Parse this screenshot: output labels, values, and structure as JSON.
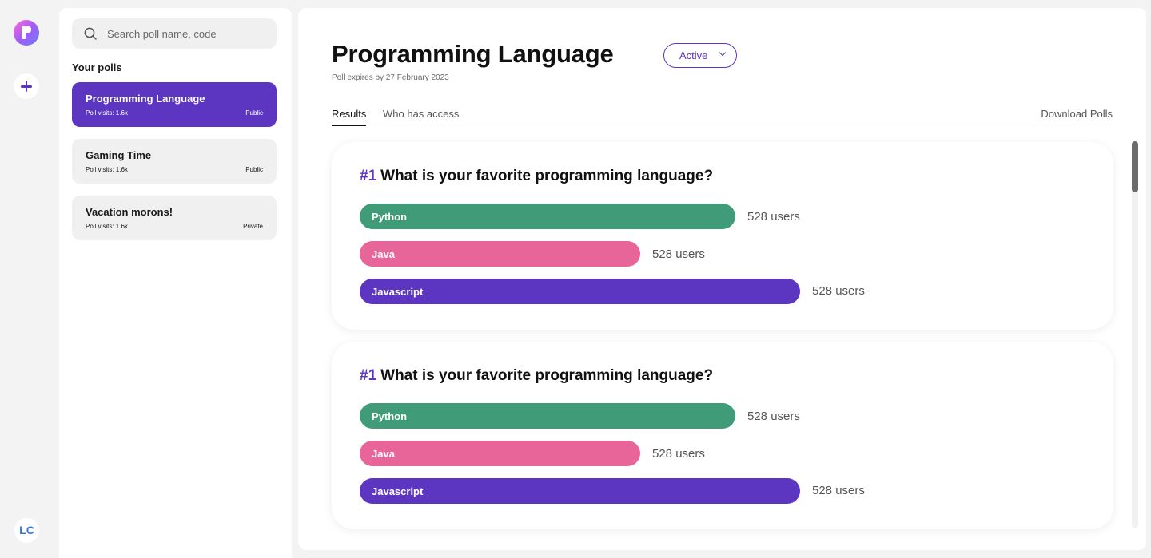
{
  "user": {
    "initials": "LC"
  },
  "search": {
    "placeholder": "Search poll name, code"
  },
  "sidebar": {
    "section_title": "Your polls",
    "polls": [
      {
        "title": "Programming Language",
        "visits": "Poll visits: 1.6k",
        "visibility": "Public",
        "active": true
      },
      {
        "title": "Gaming Time",
        "visits": "Poll visits: 1.6k",
        "visibility": "Public",
        "active": false
      },
      {
        "title": "Vacation morons!",
        "visits": "Poll visits: 1.6k",
        "visibility": "Private",
        "active": false
      }
    ]
  },
  "main": {
    "title": "Programming Language",
    "status": "Active",
    "expiry": "Poll expires by 27 February 2023",
    "tabs": [
      {
        "label": "Results",
        "active": true
      },
      {
        "label": "Who has access",
        "active": false
      }
    ],
    "download_label": "Download Polls",
    "questions": [
      {
        "number": "#1",
        "text": "What is your favorite programming language?",
        "options": [
          {
            "label": "Python",
            "count": "528 users",
            "share": 0.853,
            "color": "#409c78"
          },
          {
            "label": "Java",
            "count": "528 users",
            "share": 0.637,
            "color": "#e86599"
          },
          {
            "label": "Javascript",
            "count": "528 users",
            "share": 1.0,
            "color": "#5c35c0"
          }
        ]
      },
      {
        "number": "#1",
        "text": "What is your favorite programming language?",
        "options": [
          {
            "label": "Python",
            "count": "528 users",
            "share": 0.853,
            "color": "#409c78"
          },
          {
            "label": "Java",
            "count": "528 users",
            "share": 0.637,
            "color": "#e86599"
          },
          {
            "label": "Javascript",
            "count": "528 users",
            "share": 1.0,
            "color": "#5c35c0"
          }
        ]
      }
    ]
  },
  "colors": {
    "accent": "#5c35c0",
    "python": "#409c78",
    "java": "#e86599",
    "javascript": "#5c35c0"
  },
  "icons": {
    "logo": "app-logo-icon",
    "add": "plus-icon",
    "search": "search-icon",
    "status": "chevron-down-icon"
  }
}
